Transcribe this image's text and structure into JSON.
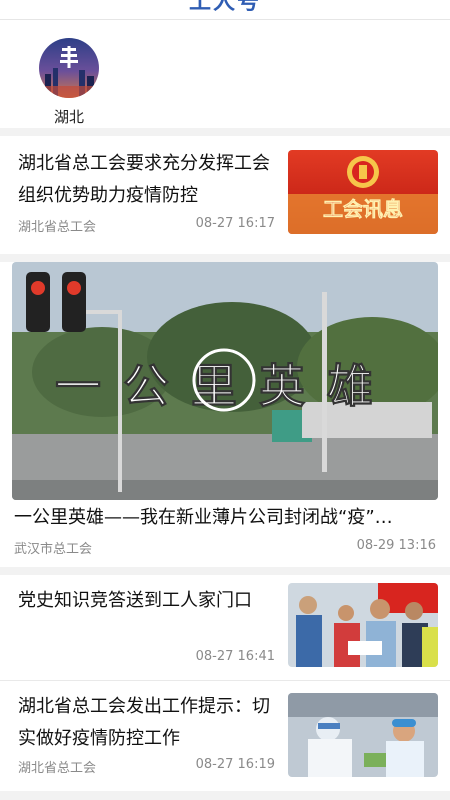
{
  "header": {
    "title": "工人号"
  },
  "channel": {
    "label": "湖北"
  },
  "articles": [
    {
      "title": "湖北省总工会要求充分发挥工会组织优势助力疫情防控",
      "source": "湖北省总工会",
      "time": "08-27 16:17",
      "thumb_text": "工会讯息"
    },
    {
      "title": "一公里英雄——我在新业薄片公司封闭战“疫”…",
      "source": "武汉市总工会",
      "time": "08-29 13:16",
      "banner_text": "一公里英雄"
    },
    {
      "title": "党史知识竞答送到工人家门口",
      "source": "",
      "time": "08-27 16:41"
    },
    {
      "title": "湖北省总工会发出工作提示：切实做好疫情防控工作",
      "source": "湖北省总工会",
      "time": "08-27 16:19"
    }
  ],
  "colors": {
    "accent": "#2f5db3",
    "red": "#d8251f"
  }
}
